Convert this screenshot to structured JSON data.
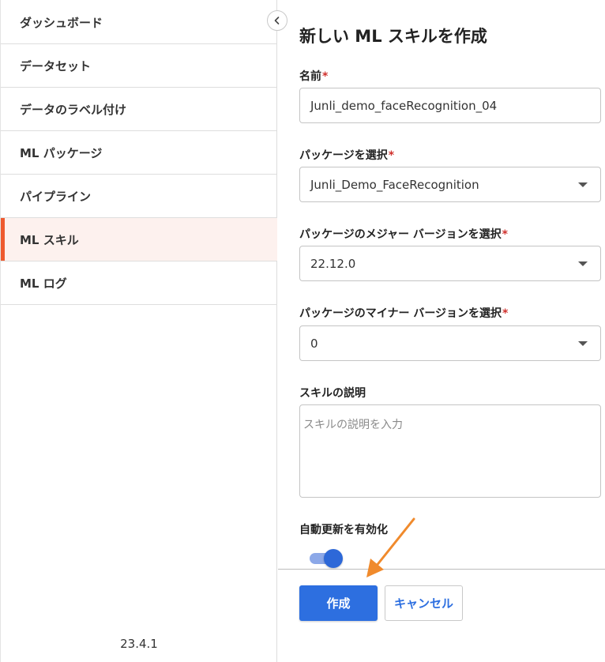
{
  "sidebar": {
    "items": [
      {
        "label": "ダッシュボード",
        "active": false
      },
      {
        "label": "データセット",
        "active": false
      },
      {
        "label": "データのラベル付け",
        "active": false
      },
      {
        "label": "ML パッケージ",
        "active": false
      },
      {
        "label": "パイプライン",
        "active": false
      },
      {
        "label": "ML スキル",
        "active": true
      },
      {
        "label": "ML ログ",
        "active": false
      }
    ],
    "version": "23.4.1",
    "collapse_icon": "chevron-left-icon"
  },
  "form": {
    "title": "新しい ML スキルを作成",
    "name": {
      "label": "名前",
      "required_mark": "*",
      "value": "Junli_demo_faceRecognition_04"
    },
    "package": {
      "label": "パッケージを選択",
      "required_mark": "*",
      "value": "Junli_Demo_FaceRecognition"
    },
    "major_version": {
      "label": "パッケージのメジャー バージョンを選択",
      "required_mark": "*",
      "value": "22.12.0"
    },
    "minor_version": {
      "label": "パッケージのマイナー バージョンを選択",
      "required_mark": "*",
      "value": "0"
    },
    "description": {
      "label": "スキルの説明",
      "placeholder": "スキルの説明を入力",
      "value": ""
    },
    "auto_update": {
      "label": "自動更新を有効化",
      "enabled": true
    },
    "create_label": "作成",
    "cancel_label": "キャンセル"
  },
  "colors": {
    "accent": "#2d6fe0",
    "active_nav_bg": "#fdf1ee",
    "active_nav_bar": "#ee5a2f",
    "required": "#d0312d",
    "annotation_arrow": "#f08a2c"
  }
}
